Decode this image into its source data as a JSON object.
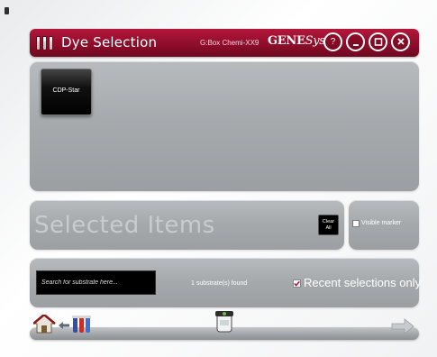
{
  "window": {
    "title": "Dye Selection",
    "device": "G:Box Chemi-XX9",
    "brand_main": "GENE",
    "brand_italic": "Sys",
    "help_label": "?"
  },
  "dyes": [
    {
      "label": "CDP-Star"
    }
  ],
  "selected": {
    "heading": "Selected Items",
    "clear_line1": "Clear",
    "clear_line2": "All"
  },
  "marker": {
    "label": "Visible marker",
    "checked": false
  },
  "search": {
    "placeholder": "Search for substrate here...",
    "value": "",
    "found": "1 substrate(s) found",
    "recent_label": "Recent selections only",
    "recent_checked": true
  },
  "nav": {
    "icons": [
      "home-icon",
      "back-arrow-icon",
      "test-tubes-icon",
      "capture-device-icon",
      "next-arrow-icon"
    ]
  },
  "colors": {
    "title_bar": "#8f0d2b",
    "panel": "#a6aaad",
    "tile": "#000000"
  }
}
